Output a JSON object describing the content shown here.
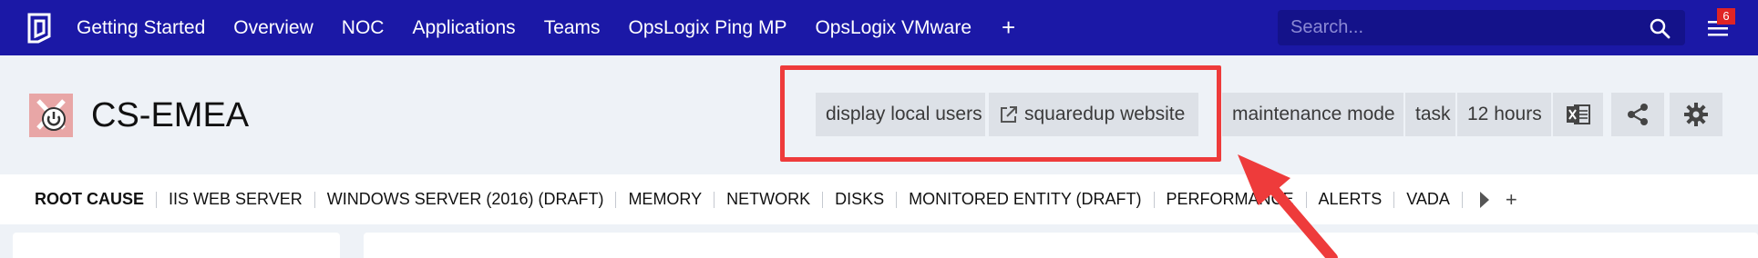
{
  "nav": {
    "items": [
      {
        "label": "Getting Started"
      },
      {
        "label": "Overview"
      },
      {
        "label": "NOC"
      },
      {
        "label": "Applications"
      },
      {
        "label": "Teams"
      },
      {
        "label": "OpsLogix Ping MP"
      },
      {
        "label": "OpsLogix VMware"
      }
    ],
    "add_label": "+",
    "search_placeholder": "Search...",
    "notification_count": "6"
  },
  "header": {
    "title": "CS-EMEA",
    "actions": {
      "display_local_users": "display local users",
      "squaredup_website": "squaredup website",
      "maintenance_mode": "maintenance mode",
      "task": "task",
      "time_range": "12 hours"
    }
  },
  "tabs": [
    {
      "label": "ROOT CAUSE",
      "active": true
    },
    {
      "label": "IIS WEB SERVER"
    },
    {
      "label": "WINDOWS SERVER (2016) (DRAFT)"
    },
    {
      "label": "MEMORY"
    },
    {
      "label": "NETWORK"
    },
    {
      "label": "DISKS"
    },
    {
      "label": "MONITORED ENTITY (DRAFT)"
    },
    {
      "label": "PERFORMANCE"
    },
    {
      "label": "ALERTS"
    },
    {
      "label": "VADA"
    }
  ],
  "tab_add_label": "+",
  "colors": {
    "nav_bg": "#1b18a6",
    "highlight": "#ee3b3b",
    "entity_icon_bg": "#e8a6a6"
  }
}
